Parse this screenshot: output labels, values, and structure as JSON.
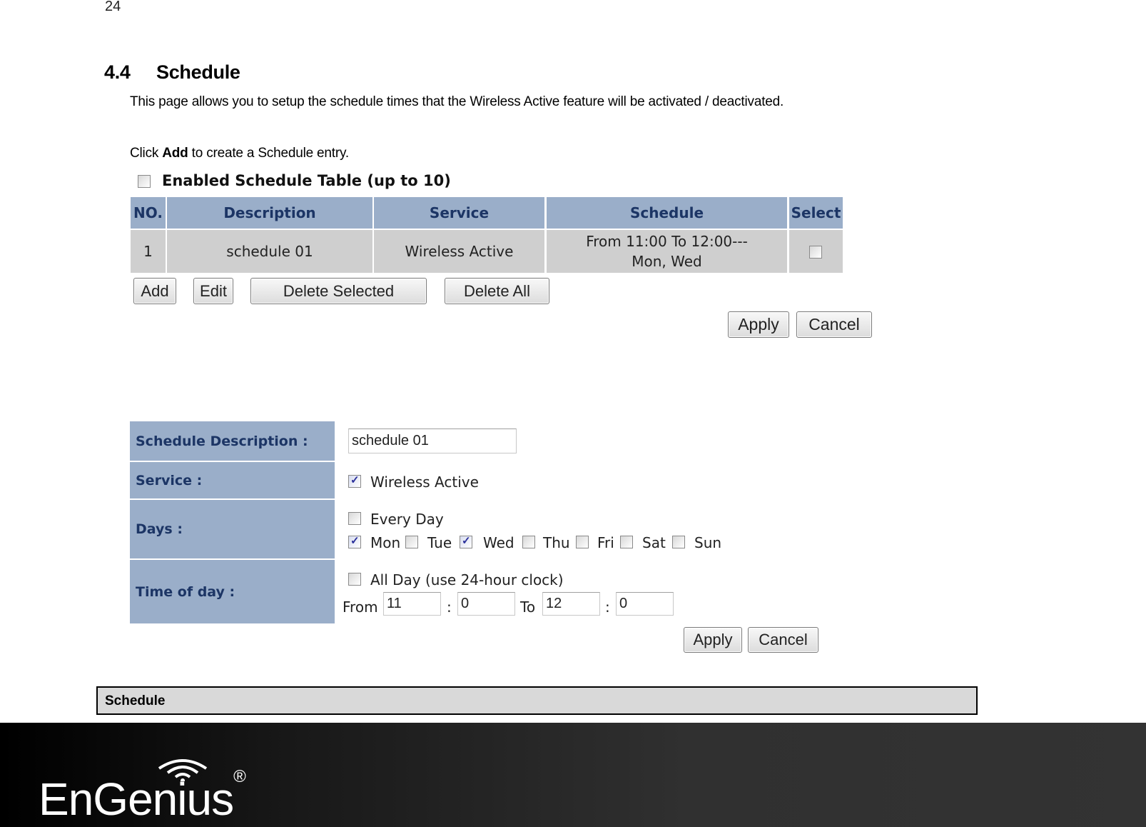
{
  "page_number": "24",
  "section": {
    "number": "4.4",
    "title": "Schedule",
    "intro": "This page allows you to setup the schedule times that the Wireless Active feature will be activated / deactivated.",
    "instruction_prefix": "Click ",
    "instruction_bold": "Add",
    "instruction_suffix": " to create a Schedule entry."
  },
  "schedule_table": {
    "enabled_label": "Enabled Schedule Table (up to 10)",
    "enabled_checked": false,
    "headers": [
      "NO.",
      "Description",
      "Service",
      "Schedule",
      "Select"
    ],
    "rows": [
      {
        "no": "1",
        "description": "schedule 01",
        "service": "Wireless Active",
        "schedule_line1": "From 11:00 To 12:00---",
        "schedule_line2": "Mon, Wed",
        "selected": false
      }
    ],
    "buttons": {
      "add": "Add",
      "edit": "Edit",
      "delete_selected": "Delete Selected",
      "delete_all": "Delete All",
      "apply": "Apply",
      "cancel": "Cancel"
    }
  },
  "schedule_form": {
    "description_label": "Schedule Description :",
    "description_value": "schedule 01",
    "service_label": "Service :",
    "service_option": "Wireless Active",
    "service_checked": true,
    "days_label": "Days :",
    "every_day": "Every Day",
    "every_day_checked": false,
    "days": [
      {
        "label": "Mon",
        "checked": true
      },
      {
        "label": "Tue",
        "checked": false
      },
      {
        "label": "Wed",
        "checked": true
      },
      {
        "label": "Thu",
        "checked": false
      },
      {
        "label": "Fri",
        "checked": false
      },
      {
        "label": "Sat",
        "checked": false
      },
      {
        "label": "Sun",
        "checked": false
      }
    ],
    "time_label": "Time of day :",
    "all_day": "All Day (use 24-hour clock)",
    "all_day_checked": false,
    "from_label": "From",
    "to_label": "To",
    "separator": ":",
    "from_hour": "11",
    "from_minute": "0",
    "to_hour": "12",
    "to_minute": "0",
    "apply": "Apply",
    "cancel": "Cancel"
  },
  "caption": "Schedule",
  "footer": {
    "brand": "EnGenius",
    "trademark": "®"
  },
  "colors": {
    "header_bg": "#9aaec9",
    "header_text": "#1c3565",
    "row_bg": "#cfcfcf",
    "footer_bg": "#333333"
  }
}
